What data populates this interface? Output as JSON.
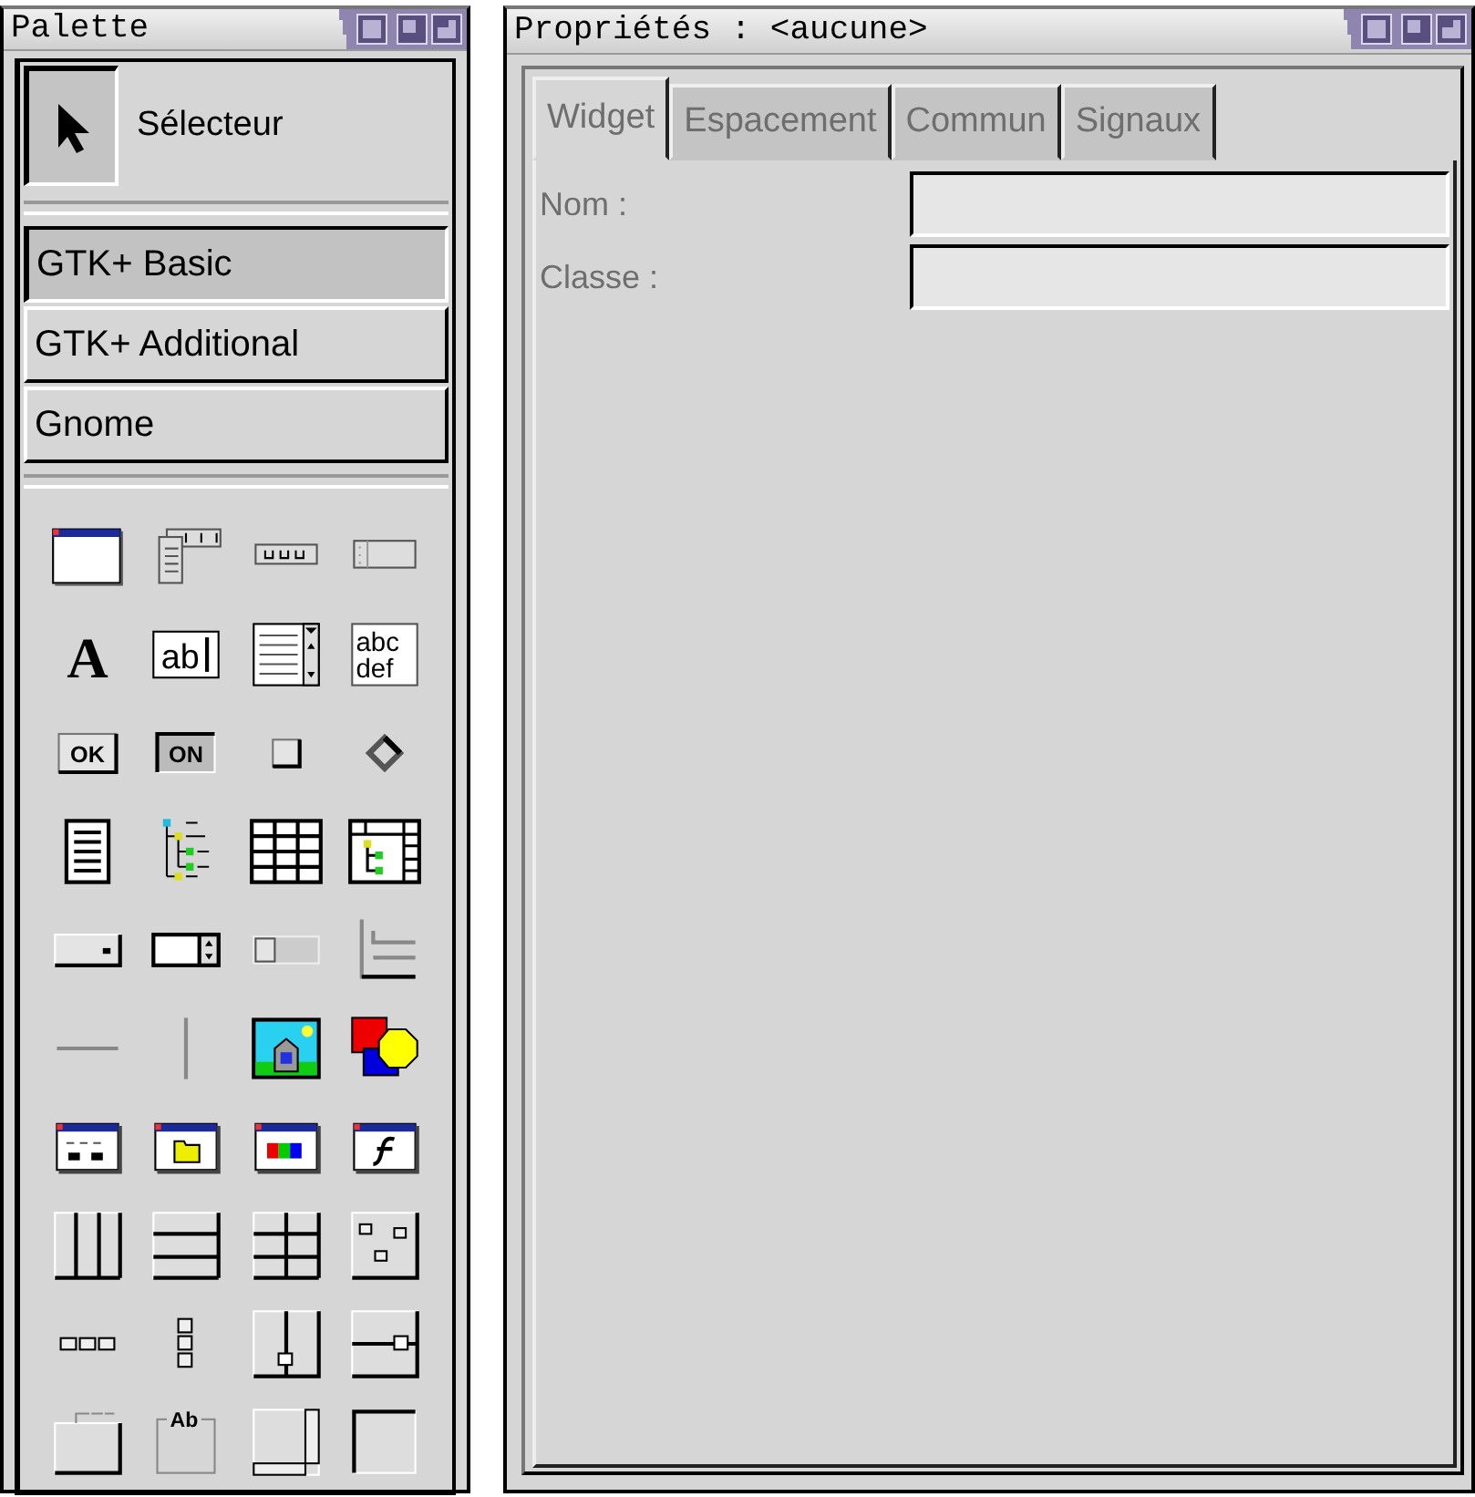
{
  "palette": {
    "title": "Palette",
    "selector": {
      "label": "Sélecteur",
      "selected": true
    },
    "groups": [
      {
        "label": "GTK+ Basic",
        "selected": true
      },
      {
        "label": "GTK+ Additional",
        "selected": false
      },
      {
        "label": "Gnome",
        "selected": false
      }
    ],
    "widgets": [
      {
        "kind": "window"
      },
      {
        "kind": "menubar"
      },
      {
        "kind": "toolbar"
      },
      {
        "kind": "handlebox"
      },
      {
        "kind": "label",
        "text": "A"
      },
      {
        "kind": "entry",
        "text": "ab"
      },
      {
        "kind": "combo"
      },
      {
        "kind": "textbox",
        "lines": [
          "abc",
          "def"
        ]
      },
      {
        "kind": "button",
        "text": "OK"
      },
      {
        "kind": "toggle",
        "text": "ON"
      },
      {
        "kind": "checkbox"
      },
      {
        "kind": "radio"
      },
      {
        "kind": "list"
      },
      {
        "kind": "tree"
      },
      {
        "kind": "clist"
      },
      {
        "kind": "ctree"
      },
      {
        "kind": "optionmenu"
      },
      {
        "kind": "spin"
      },
      {
        "kind": "scrollbar"
      },
      {
        "kind": "ruler"
      },
      {
        "kind": "hsep"
      },
      {
        "kind": "vsep"
      },
      {
        "kind": "image"
      },
      {
        "kind": "drawing"
      },
      {
        "kind": "dialog"
      },
      {
        "kind": "filesel"
      },
      {
        "kind": "colorsel"
      },
      {
        "kind": "fontsel"
      },
      {
        "kind": "hbox"
      },
      {
        "kind": "vbox"
      },
      {
        "kind": "table"
      },
      {
        "kind": "fixed"
      },
      {
        "kind": "hbuttonbox"
      },
      {
        "kind": "vbuttonbox"
      },
      {
        "kind": "vpaned"
      },
      {
        "kind": "hpaned"
      },
      {
        "kind": "notebook"
      },
      {
        "kind": "frame",
        "text": "Ab"
      },
      {
        "kind": "scrolled"
      },
      {
        "kind": "viewport"
      }
    ]
  },
  "properties": {
    "title": "Propriétés : <aucune>",
    "disabled": true,
    "tabs": [
      {
        "label": "Widget",
        "selected": true
      },
      {
        "label": "Espacement",
        "selected": false
      },
      {
        "label": "Commun",
        "selected": false
      },
      {
        "label": "Signaux",
        "selected": false
      }
    ],
    "fields": [
      {
        "label": "Nom :"
      },
      {
        "label": "Classe :"
      }
    ]
  }
}
